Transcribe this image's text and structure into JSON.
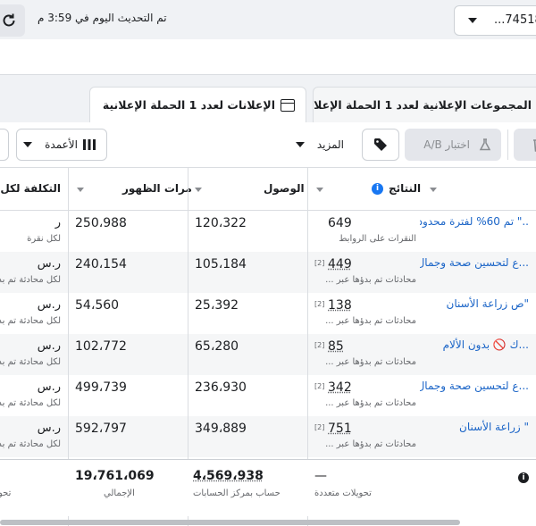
{
  "topbar": {
    "updated_text": "تم التحديث اليوم في 3:59 م",
    "account_label": "...745180"
  },
  "tabs": {
    "adsets": {
      "label_pre": "المجموعات الإعلانية لعدد",
      "count": "1",
      "label_post": "الحملة الإعلانية"
    },
    "ads": {
      "label_pre": "الإعلانات لعدد",
      "count": "1",
      "label_post": "الحملة الإعلانية"
    }
  },
  "toolbar": {
    "ab_test_label": "اختبار A/B",
    "more_label": "المزيد",
    "columns_label": "الأعمدة"
  },
  "table": {
    "headers": {
      "results": "النتائج",
      "reach": "الوصول",
      "impressions": "مرات الظهور",
      "cost": "التكلفة لكل نتيجة"
    },
    "rows": [
      {
        "ad_name": "..\" تم 60% لفترة محدودة",
        "result": "649",
        "result_sup": "",
        "result_sub": "النقرات على الروابط",
        "reach": "120،322",
        "impressions": "250،988",
        "cost": "ر",
        "cost_sub": "لكل نقرة"
      },
      {
        "ad_name": "...ع لتحسين صحة وجمال",
        "result": "449",
        "result_sup": "[2]",
        "result_sub": "محادثات تم بدؤها عبر ...",
        "reach": "105،184",
        "impressions": "240،154",
        "cost": "ر.س",
        "cost_sub": "لكل محادثة تم بد"
      },
      {
        "ad_name": "\"ص زراعة الأسنان",
        "result": "138",
        "result_sup": "[2]",
        "result_sub": "محادثات تم بدؤها عبر ...",
        "reach": "25،392",
        "impressions": "54،560",
        "cost": "ر.س",
        "cost_sub": "لكل محادثة تم بد"
      },
      {
        "ad_name": "...ك 🚫 بدون الألام",
        "result": "85",
        "result_sup": "[2]",
        "result_sub": "محادثات تم بدؤها عبر ...",
        "reach": "65،280",
        "impressions": "102،772",
        "cost": "ر.س",
        "cost_sub": "لكل محادثة تم بد"
      },
      {
        "ad_name": "...ع لتحسين صحة وجمال",
        "result": "342",
        "result_sup": "[2]",
        "result_sub": "محادثات تم بدؤها عبر ...",
        "reach": "236،930",
        "impressions": "499،739",
        "cost": "ر.س",
        "cost_sub": "لكل محادثة تم بد"
      },
      {
        "ad_name": "\" زراعة الأسنان",
        "result": "751",
        "result_sup": "[2]",
        "result_sub": "محادثات تم بدؤها عبر ...",
        "reach": "349،889",
        "impressions": "592،797",
        "cost": "ر.س",
        "cost_sub": "لكل محادثة تم بد"
      }
    ]
  },
  "footer": {
    "results_total": "—",
    "results_sub": "تحويلات متعددة",
    "reach_total": "4،569،938",
    "reach_sub": "حساب بمركز الحسابات",
    "impressions_total": "19،761،069",
    "impressions_sub": "الإجمالي",
    "cost_sub": "تحو"
  }
}
